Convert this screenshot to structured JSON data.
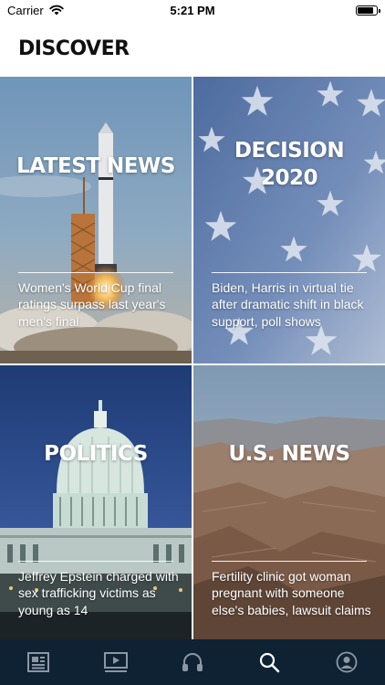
{
  "status_bar": {
    "carrier": "Carrier",
    "time": "5:21 PM",
    "icons": [
      "wifi-icon",
      "battery-icon"
    ],
    "battery_level": 0.85
  },
  "header": {
    "title": "DISCOVER"
  },
  "tiles": [
    {
      "title": "LATEST NEWS",
      "headline": "Women's World Cup final ratings surpass last year's men's final",
      "image": "rocket-launch"
    },
    {
      "title": "DECISION\n2020",
      "headline": "Biden, Harris in virtual tie after dramatic shift in black support, poll shows",
      "image": "american-flag"
    },
    {
      "title": "POLITICS",
      "headline": "Jeffrey Epstein charged with sex trafficking victims as young as 14",
      "image": "capitol-building"
    },
    {
      "title": "U.S. NEWS",
      "headline": "Fertility clinic got woman pregnant with someone else's babies, lawsuit claims",
      "image": "grand-canyon"
    }
  ],
  "tab_bar": {
    "items": [
      "news-icon",
      "video-icon",
      "headphones-icon",
      "search-icon",
      "profile-icon"
    ],
    "selected": "search-icon",
    "background": "#0f2233",
    "icon_color": "#8b97a3",
    "selected_color": "#ffffff"
  }
}
